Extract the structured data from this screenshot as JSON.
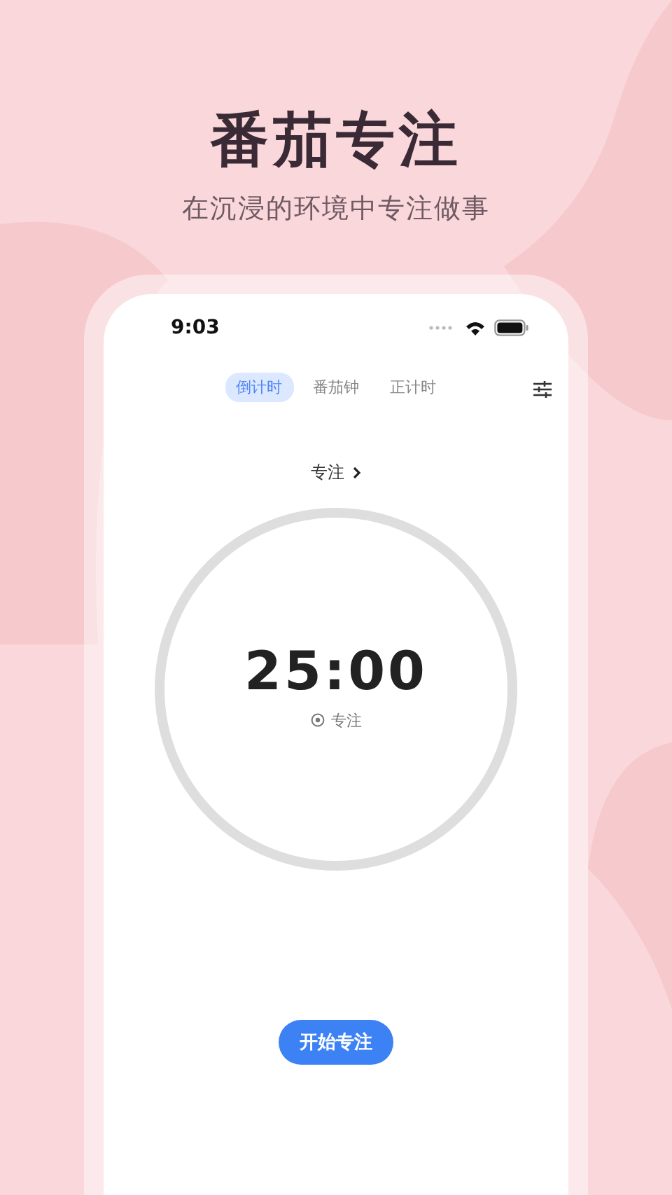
{
  "headline": "番茄专注",
  "subtitle": "在沉浸的环境中专注做事",
  "status_bar": {
    "time": "9:03"
  },
  "tabs": [
    {
      "label": "倒计时",
      "selected": true
    },
    {
      "label": "番茄钟",
      "selected": false
    },
    {
      "label": "正计时",
      "selected": false
    }
  ],
  "mode_selector": {
    "label": "专注"
  },
  "timer": {
    "time": "25:00",
    "caption": "专注"
  },
  "start_button": {
    "label": "开始专注"
  }
}
